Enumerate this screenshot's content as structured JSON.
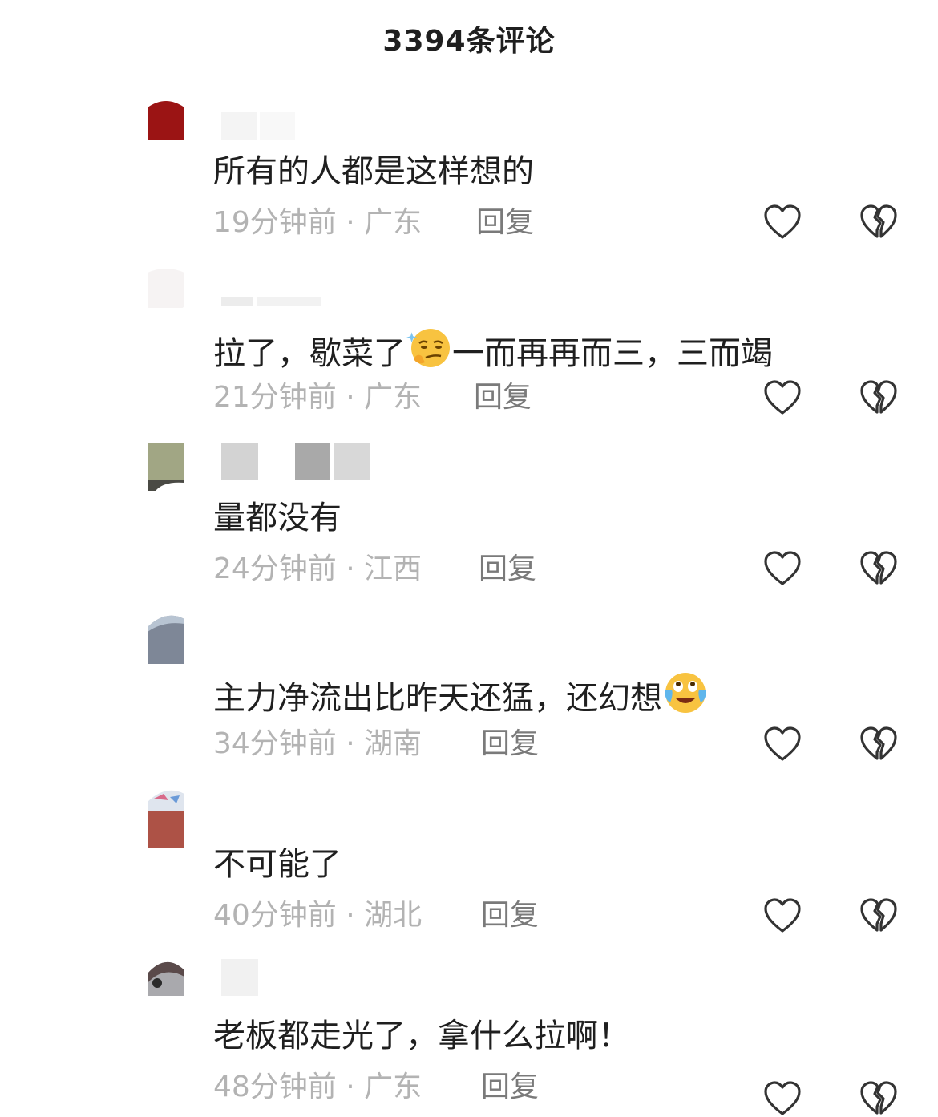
{
  "header": {
    "title": "3394条评论"
  },
  "comments": [
    {
      "text": "所有的人都是这样想的",
      "time": "19分钟前",
      "sep": "·",
      "location": "广东",
      "reply": "回复"
    },
    {
      "text_a": "拉了，歇菜了",
      "text_b": "一而再再而三，三而竭",
      "time": "21分钟前",
      "sep": "·",
      "location": "广东",
      "reply": "回复",
      "emoji": "smirk-thinking-emoji"
    },
    {
      "text": "量都没有",
      "time": "24分钟前",
      "sep": "·",
      "location": "江西",
      "reply": "回复"
    },
    {
      "text": "主力净流出比昨天还猛，还幻想",
      "time": "34分钟前",
      "sep": "·",
      "location": "湖南",
      "reply": "回复",
      "emoji": "tears-of-joy-emoji"
    },
    {
      "text": "不可能了",
      "time": "40分钟前",
      "sep": "·",
      "location": "湖北",
      "reply": "回复"
    },
    {
      "text": "老板都走光了，拿什么拉啊！",
      "time": "48分钟前",
      "sep": "·",
      "location": "广东",
      "reply": "回复"
    }
  ],
  "icons": {
    "like": "heart-icon",
    "dislike": "broken-heart-icon"
  },
  "colors": {
    "text": "#1f1f1f",
    "meta": "#b3b3b3",
    "reply": "#7a7a7a",
    "icon": "#333333"
  }
}
